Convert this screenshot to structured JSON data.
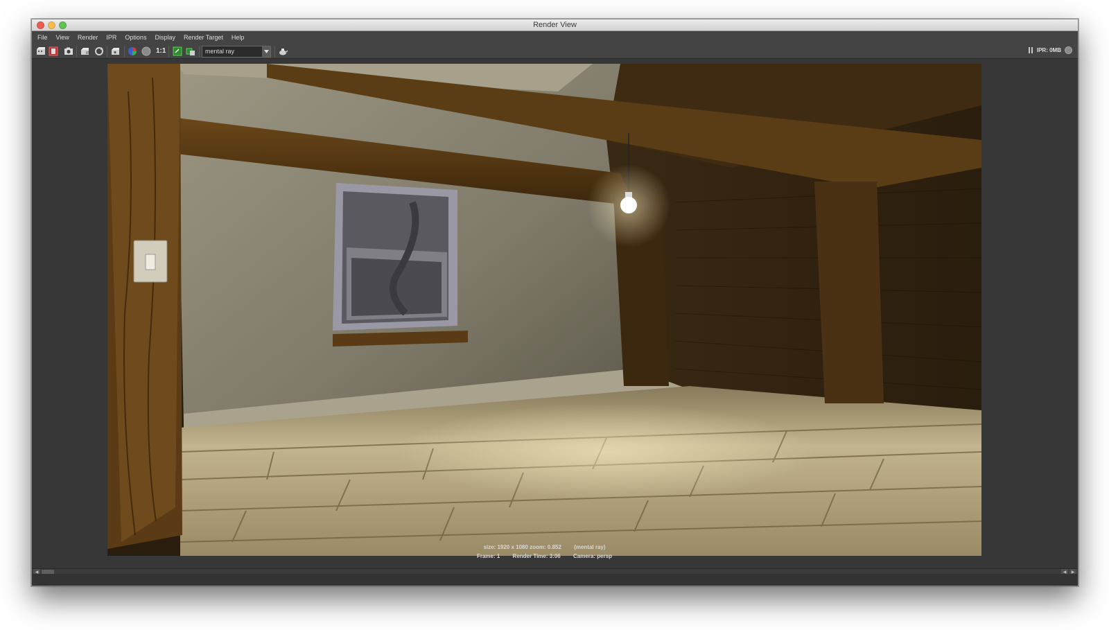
{
  "window": {
    "title": "Render View"
  },
  "menu": {
    "items": [
      "File",
      "View",
      "Render",
      "IPR",
      "Options",
      "Display",
      "Render Target",
      "Help"
    ]
  },
  "toolbar": {
    "ratio_label": "1:1",
    "renderer": "mental ray",
    "icons": [
      "redo-render-icon",
      "render-region-icon",
      "snapshot-icon",
      "ipr-render-icon",
      "refresh-icon",
      "keep-image-icon",
      "color-channels-icon",
      "alpha-channel-icon",
      "keep-image-green-icon",
      "remove-image-icon",
      "teapot-icon"
    ]
  },
  "status": {
    "ipr": "IPR: 0MB"
  },
  "render_info": {
    "line1_size": "size: 1920 x 1080 zoom: 0.852",
    "line1_renderer": "(mental ray)",
    "line2_frame": "Frame: 1",
    "line2_time": "Render Time:  3:06",
    "line2_camera": "Camera: persp"
  },
  "colors": {
    "window_bg": "#333333",
    "toolbar_bg": "#444444",
    "floor": "#b9aa86",
    "wall": "#8f8a78",
    "wood": "#4a3114"
  }
}
